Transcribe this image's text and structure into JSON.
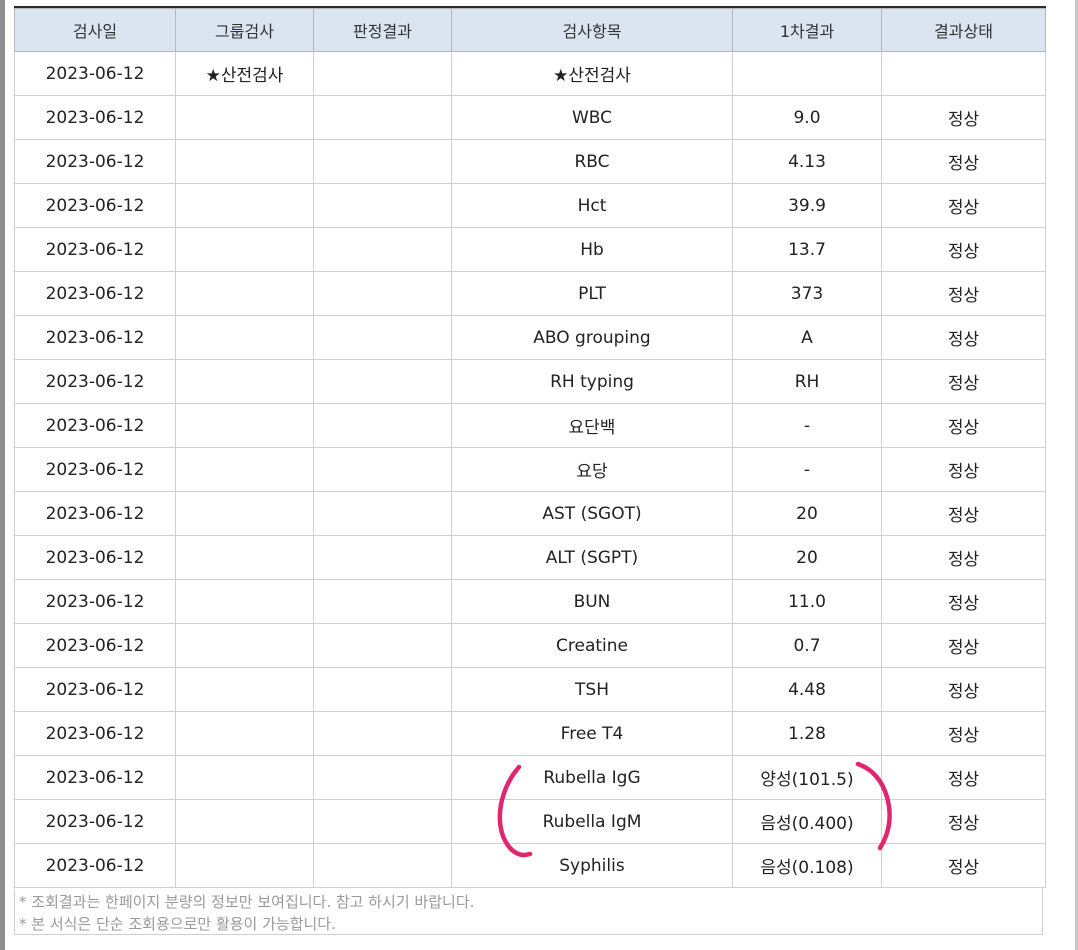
{
  "table": {
    "headers": [
      "검사일",
      "그룹검사",
      "판정결과",
      "검사항목",
      "1차결과",
      "결과상태"
    ],
    "rows": [
      {
        "date": "2023-06-12",
        "group": "★산전검사",
        "judgment": "",
        "item": "★산전검사",
        "result": "",
        "status": ""
      },
      {
        "date": "2023-06-12",
        "group": "",
        "judgment": "",
        "item": "WBC",
        "result": "9.0",
        "status": "정상"
      },
      {
        "date": "2023-06-12",
        "group": "",
        "judgment": "",
        "item": "RBC",
        "result": "4.13",
        "status": "정상"
      },
      {
        "date": "2023-06-12",
        "group": "",
        "judgment": "",
        "item": "Hct",
        "result": "39.9",
        "status": "정상"
      },
      {
        "date": "2023-06-12",
        "group": "",
        "judgment": "",
        "item": "Hb",
        "result": "13.7",
        "status": "정상"
      },
      {
        "date": "2023-06-12",
        "group": "",
        "judgment": "",
        "item": "PLT",
        "result": "373",
        "status": "정상"
      },
      {
        "date": "2023-06-12",
        "group": "",
        "judgment": "",
        "item": "ABO grouping",
        "result": "A",
        "status": "정상"
      },
      {
        "date": "2023-06-12",
        "group": "",
        "judgment": "",
        "item": "RH typing",
        "result": "RH",
        "status": "정상"
      },
      {
        "date": "2023-06-12",
        "group": "",
        "judgment": "",
        "item": "요단백",
        "result": "-",
        "status": "정상"
      },
      {
        "date": "2023-06-12",
        "group": "",
        "judgment": "",
        "item": "요당",
        "result": "-",
        "status": "정상"
      },
      {
        "date": "2023-06-12",
        "group": "",
        "judgment": "",
        "item": "AST (SGOT)",
        "result": "20",
        "status": "정상"
      },
      {
        "date": "2023-06-12",
        "group": "",
        "judgment": "",
        "item": "ALT (SGPT)",
        "result": "20",
        "status": "정상"
      },
      {
        "date": "2023-06-12",
        "group": "",
        "judgment": "",
        "item": "BUN",
        "result": "11.0",
        "status": "정상"
      },
      {
        "date": "2023-06-12",
        "group": "",
        "judgment": "",
        "item": "Creatine",
        "result": "0.7",
        "status": "정상"
      },
      {
        "date": "2023-06-12",
        "group": "",
        "judgment": "",
        "item": "TSH",
        "result": "4.48",
        "status": "정상"
      },
      {
        "date": "2023-06-12",
        "group": "",
        "judgment": "",
        "item": "Free T4",
        "result": "1.28",
        "status": "정상"
      },
      {
        "date": "2023-06-12",
        "group": "",
        "judgment": "",
        "item": "Rubella IgG",
        "result": "양성(101.5)",
        "status": "정상"
      },
      {
        "date": "2023-06-12",
        "group": "",
        "judgment": "",
        "item": "Rubella IgM",
        "result": "음성(0.400)",
        "status": "정상"
      },
      {
        "date": "2023-06-12",
        "group": "",
        "judgment": "",
        "item": "Syphilis",
        "result": "음성(0.108)",
        "status": "정상"
      }
    ]
  },
  "footer": {
    "note1": "* 조회결과는 한페이지 분량의 정보만 보여집니다. 참고 하시기 바랍니다.",
    "note2": "* 본 서식은 단순 조회용으로만 활용이 가능합니다."
  },
  "colors": {
    "header_bg": "#dbe5f1",
    "annotation": "#e0266e"
  }
}
